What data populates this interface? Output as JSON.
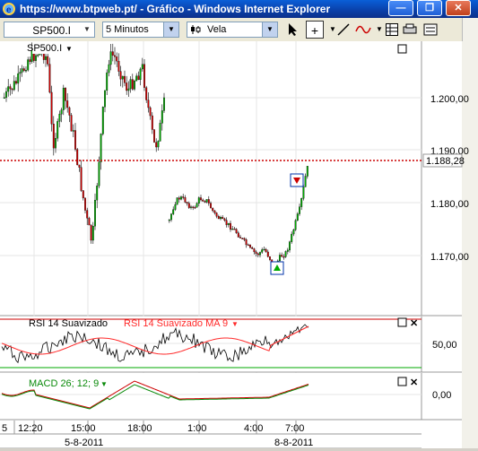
{
  "window": {
    "title": "https://www.btpweb.pt/ - Gráfico - Windows Internet Explorer",
    "minimize_glyph": "—",
    "restore_glyph": "❐",
    "close_glyph": "✕"
  },
  "toolbar": {
    "symbol": "SP500.I",
    "interval": "5 Minutos",
    "chart_style": "Vela",
    "cursor_icon": "arrow-cursor-icon",
    "crosshair_icon": "crosshair-icon"
  },
  "price_panel": {
    "label": "SP500.I",
    "y_ticks": [
      "1.200,00",
      "1.190,00",
      "1.180,00",
      "1.170,00"
    ],
    "last_price": "1.188,28",
    "last_price_color": "#cc0000"
  },
  "rsi_panel": {
    "label": "RSI 14 Suavizado",
    "ma_label": "RSI 14 Suavizado MA 9",
    "y_tick": "50,00",
    "line_color": "#000000",
    "ma_color": "#ff2a2a"
  },
  "macd_panel": {
    "label": "MACD 26; 12; 9",
    "y_tick": "0,00",
    "label_color": "#0a8a0a"
  },
  "time_axis": {
    "ticks": [
      "5",
      "12:20",
      "15:00",
      "18:00",
      "1:00",
      "4:00",
      "7:00"
    ],
    "dates": [
      "5-8-2011",
      "8-8-2011"
    ]
  },
  "colors": {
    "up_candle": "#00aa00",
    "down_candle": "#cc0000",
    "grid": "#e5e5e5"
  }
}
